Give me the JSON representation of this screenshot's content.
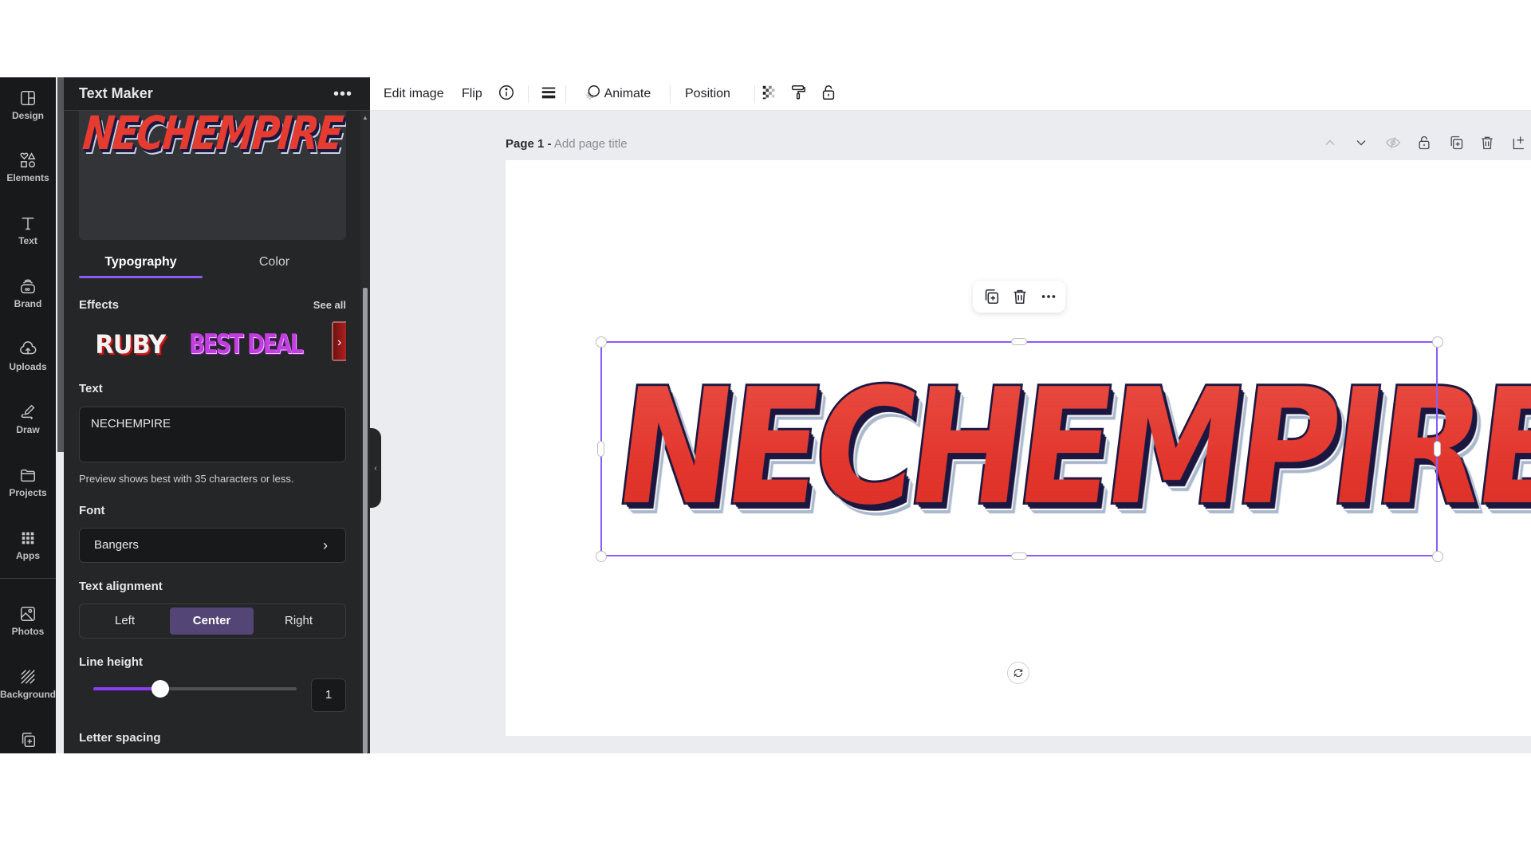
{
  "rail": {
    "items": [
      {
        "label": "Design",
        "icon": "design-icon"
      },
      {
        "label": "Elements",
        "icon": "elements-icon"
      },
      {
        "label": "Text",
        "icon": "text-icon"
      },
      {
        "label": "Brand",
        "icon": "brand-icon"
      },
      {
        "label": "Uploads",
        "icon": "uploads-icon"
      },
      {
        "label": "Draw",
        "icon": "draw-icon"
      },
      {
        "label": "Projects",
        "icon": "projects-icon"
      },
      {
        "label": "Apps",
        "icon": "apps-icon"
      },
      {
        "label": "Photos",
        "icon": "photos-icon"
      },
      {
        "label": "Background",
        "icon": "background-icon"
      },
      {
        "label": "Bulk create",
        "icon": "bulk-create-icon"
      }
    ]
  },
  "panel": {
    "title": "Text Maker",
    "more_label": "•••",
    "preview_text": "NECHEMPIRE",
    "tabs": [
      {
        "label": "Typography",
        "active": true
      },
      {
        "label": "Color",
        "active": false
      }
    ],
    "effects": {
      "label": "Effects",
      "see_all": "See all",
      "items": [
        "RUBY",
        "BEST DEAL"
      ],
      "next_label": "›"
    },
    "text": {
      "label": "Text",
      "value": "NECHEMPIRE",
      "hint": "Preview shows best with 35 characters or less."
    },
    "font": {
      "label": "Font",
      "value": "Bangers",
      "chevron": "›"
    },
    "alignment": {
      "label": "Text alignment",
      "options": [
        "Left",
        "Center",
        "Right"
      ],
      "selected": "Center"
    },
    "line_height": {
      "label": "Line height",
      "value": "1",
      "slider_fraction": 0.33
    },
    "letter_spacing": {
      "label": "Letter spacing"
    }
  },
  "toolbar": {
    "edit_image": "Edit image",
    "flip": "Flip",
    "animate": "Animate",
    "position": "Position"
  },
  "page": {
    "title_prefix": "Page 1 -",
    "title_placeholder": "Add page title"
  },
  "canvas": {
    "text": "NECHEMPIRE",
    "colors": {
      "fill": "#e63b30",
      "outline": "#1b1740",
      "shadow": "#aab8cc",
      "selection": "#8b5cf6"
    }
  }
}
